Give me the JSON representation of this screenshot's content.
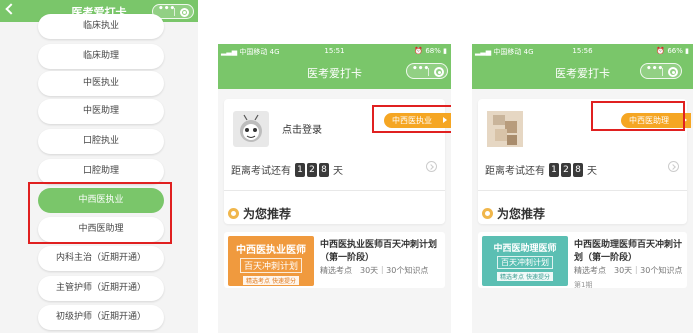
{
  "app_title": "医考爱打卡",
  "exam_list": {
    "items": [
      {
        "label": "临床执业"
      },
      {
        "label": "临床助理"
      },
      {
        "label": "中医执业"
      },
      {
        "label": "中医助理"
      },
      {
        "label": "口腔执业"
      },
      {
        "label": "口腔助理"
      },
      {
        "label": "中西医执业",
        "selected": true
      },
      {
        "label": "中西医助理"
      },
      {
        "label": "内科主治（近期开通）"
      },
      {
        "label": "主管护师（近期开通）"
      },
      {
        "label": "初级护师（近期开通）"
      }
    ]
  },
  "phone_left": {
    "status": {
      "carrier": "中国移动",
      "network": "4G",
      "time": "15:51",
      "battery": "68%"
    },
    "login_text": "点击登录",
    "exam_tag": "中西医执业",
    "countdown_prefix": "距离考试还有",
    "countdown_digits": [
      "1",
      "2",
      "8"
    ],
    "countdown_unit": "天",
    "section_title": "为您推荐",
    "course": {
      "thumb_title": "中西医执业医师",
      "thumb_subtitle": "百天冲刺计划",
      "thumb_tag": "精选考点 快速提分",
      "title": "中西医执业医师百天冲刺计划（第一阶段）",
      "meta": "精选考点　30天｜30个知识点"
    }
  },
  "phone_right": {
    "status": {
      "carrier": "中国移动",
      "network": "4G",
      "time": "15:56",
      "battery": "66%"
    },
    "exam_tag": "中西医助理",
    "countdown_prefix": "距离考试还有",
    "countdown_digits": [
      "1",
      "2",
      "8"
    ],
    "countdown_unit": "天",
    "section_title": "为您推荐",
    "course": {
      "thumb_title": "中西医助理医师",
      "thumb_subtitle": "百天冲刺计划",
      "thumb_tag": "精选考点 快速提分",
      "title": "中西医助理医师百天冲刺计划（第一阶段）",
      "meta": "精选考点　30天｜30个知识点",
      "extra": "第1期"
    }
  },
  "colors": {
    "brand_green": "#7ac66a",
    "tag_orange": "#f5a623",
    "highlight_red": "#e02020"
  }
}
